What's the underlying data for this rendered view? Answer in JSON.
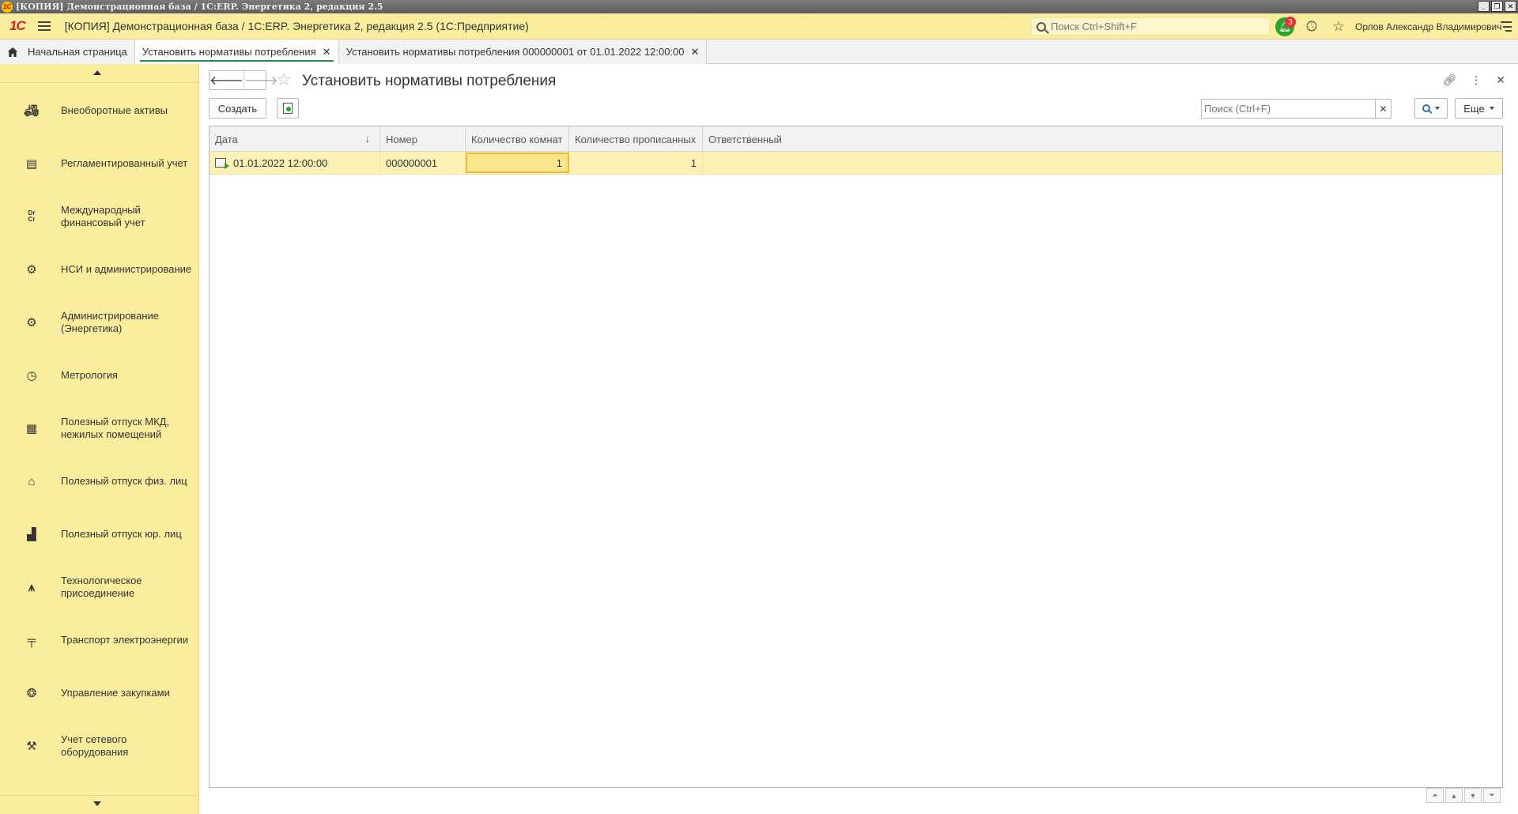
{
  "os_window": {
    "title": "[КОПИЯ] Демонстрационная база / 1C:ERP. Энергетика 2, редакция 2.5",
    "buttons": [
      "_",
      "❐",
      "✕"
    ]
  },
  "header": {
    "logo": "1С",
    "title": "[КОПИЯ] Демонстрационная база / 1C:ERP. Энергетика 2, редакция 2.5  (1С:Предприятие)",
    "search_placeholder": "Поиск Ctrl+Shift+F",
    "notifications_count": "3",
    "user": "Орлов Александр Владимирович"
  },
  "tabs": [
    {
      "label": "Начальная страница"
    },
    {
      "label": "Установить нормативы потребления"
    },
    {
      "label": "Установить нормативы потребления 000000001 от 01.01.2022 12:00:00"
    }
  ],
  "sidebar": {
    "items": [
      {
        "label": "Внеоборотные активы",
        "icon": "tractor-icon"
      },
      {
        "label": "Регламентированный учет",
        "icon": "ledger-icon"
      },
      {
        "label": "Международный финансовый учет",
        "icon": "dr-cr-icon"
      },
      {
        "label": "НСИ и администрирование",
        "icon": "gear-icon"
      },
      {
        "label": "Администрирование (Энергетика)",
        "icon": "gear-icon"
      },
      {
        "label": "Метрология",
        "icon": "gauge-icon"
      },
      {
        "label": "Полезный отпуск МКД, нежилых помещений",
        "icon": "buildings-icon"
      },
      {
        "label": "Полезный отпуск физ. лиц",
        "icon": "house-icon"
      },
      {
        "label": "Полезный отпуск юр. лиц",
        "icon": "factory-icon"
      },
      {
        "label": "Технологическое присоединение",
        "icon": "tower-icon"
      },
      {
        "label": "Транспорт электроэнергии",
        "icon": "pole-icon"
      },
      {
        "label": "Управление закупками",
        "icon": "purchase-icon"
      },
      {
        "label": "Учет сетевого оборудования",
        "icon": "tools-icon"
      }
    ]
  },
  "form": {
    "title": "Установить нормативы потребления",
    "create_label": "Создать",
    "search_placeholder": "Поиск (Ctrl+F)",
    "more_label": "Еще"
  },
  "table": {
    "columns": [
      "Дата",
      "Номер",
      "Количество комнат",
      "Количество прописанных",
      "Ответственный"
    ],
    "rows": [
      {
        "date": "01.01.2022 12:00:00",
        "number": "000000001",
        "rooms": "1",
        "registered": "1",
        "responsible": ""
      }
    ]
  },
  "colors": {
    "header_bg": "#fbed9e",
    "row_selected": "#fbf1b4",
    "cell_focus": "#e9bb3b",
    "accent_green": "#2b8a3e"
  }
}
